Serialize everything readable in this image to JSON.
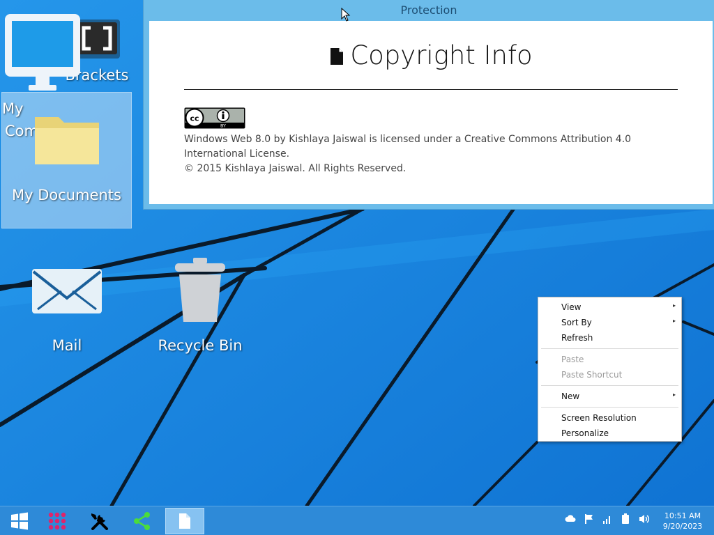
{
  "window": {
    "title": "Protection",
    "heading": "Copyright Info",
    "license_line": "Windows Web 8.0 by Kishlaya Jaiswal is licensed under a Creative Commons Attribution 4.0 International License.",
    "copyright_line": "© 2015 Kishlaya Jaiswal. All Rights Reserved.",
    "cc_badge": {
      "left": "cc",
      "mid": "BY"
    }
  },
  "desktop": {
    "icons": [
      {
        "label": "Brackets",
        "icon": "brackets-icon"
      },
      {
        "label": "My Computer",
        "label_visible_1": "My",
        "label_visible_2": "Com",
        "icon": "monitor-icon"
      },
      {
        "label": "My Documents",
        "icon": "folder-icon"
      },
      {
        "label": "Mail",
        "icon": "mail-icon"
      },
      {
        "label": "Recycle Bin",
        "icon": "trash-icon"
      }
    ]
  },
  "context_menu": {
    "items": [
      {
        "label": "View",
        "submenu": true,
        "enabled": true
      },
      {
        "label": "Sort By",
        "submenu": true,
        "enabled": true
      },
      {
        "label": "Refresh",
        "submenu": false,
        "enabled": true
      },
      {
        "label": "Paste",
        "submenu": false,
        "enabled": false
      },
      {
        "label": "Paste Shortcut",
        "submenu": false,
        "enabled": false
      },
      {
        "label": "New",
        "submenu": true,
        "enabled": true
      },
      {
        "label": "Screen Resolution",
        "submenu": false,
        "enabled": true
      },
      {
        "label": "Personalize",
        "submenu": false,
        "enabled": true
      }
    ],
    "submenu_glyph": "▸"
  },
  "taskbar": {
    "buttons": [
      {
        "icon": "windows-start-icon"
      },
      {
        "icon": "apps-grid-icon"
      },
      {
        "icon": "tools-icon"
      },
      {
        "icon": "share-icon"
      },
      {
        "icon": "document-icon",
        "active": true
      }
    ],
    "tray": [
      "cloud-icon",
      "flag-icon",
      "signal-icon",
      "battery-icon",
      "volume-icon"
    ],
    "time": "10:51 AM",
    "date": "9/20/2023"
  },
  "colors": {
    "desktop": "#1a86e0",
    "taskbar": "#2e8ad8",
    "window_frame": "#6bbcea",
    "start_accent": "#ffffff",
    "apps_grid": "#e0246b",
    "share_green": "#4bdc3c"
  }
}
